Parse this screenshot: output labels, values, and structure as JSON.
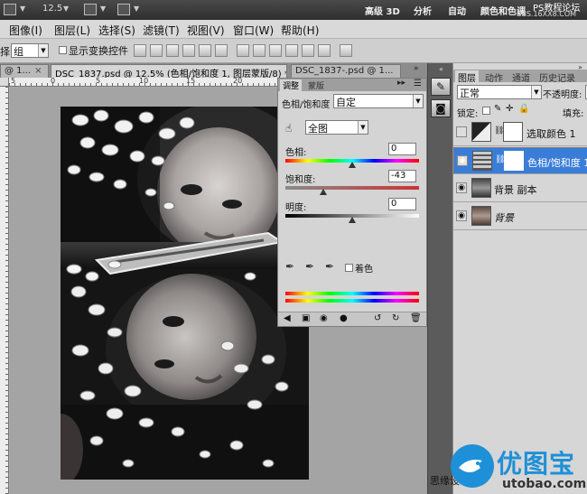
{
  "appbar": {
    "zoom": "12.5",
    "workspaces": [
      "高级 3D",
      "分析",
      "自动",
      "颜色和色调"
    ],
    "overlay_top": "PS教程论坛",
    "overlay_bottom": "BBS.16XX8.COM"
  },
  "menu": [
    "图像(I)",
    "图层(L)",
    "选择(S)",
    "滤镜(T)",
    "视图(V)",
    "窗口(W)",
    "帮助(H)"
  ],
  "options": {
    "left_label": "择:",
    "group_value": "组",
    "show_transform": "显示变换控件"
  },
  "tabs": [
    {
      "label": "@ 1...",
      "close": "×"
    },
    {
      "label": "DSC_1837.psd @ 12.5% (色相/饱和度 1, 图层蒙版/8) *",
      "close": "×"
    },
    {
      "label": "DSC_1837-.psd @ 1...",
      "close": ""
    }
  ],
  "ruler_labels": [
    "5",
    "0",
    "5",
    "10",
    "15",
    "20",
    "25",
    "30",
    "35"
  ],
  "adjustments": {
    "tab_adjust": "调整",
    "tab_mask": "蒙版",
    "title": "色相/饱和度",
    "preset_value": "自定",
    "range_value": "全图",
    "hue_label": "色相:",
    "hue_value": "0",
    "hue_pos": 0.5,
    "sat_label": "饱和度:",
    "sat_value": "-43",
    "sat_pos": 0.285,
    "light_label": "明度:",
    "light_value": "0",
    "light_pos": 0.5,
    "colorize_label": "着色"
  },
  "layers_panel": {
    "tabs": [
      "图层",
      "动作",
      "通道",
      "历史记录"
    ],
    "blend_mode": "正常",
    "opacity_label": "不透明度:",
    "lock_label": "锁定:",
    "fill_label": "填充:",
    "layers": [
      {
        "name": "选取颜色 1",
        "selected": false
      },
      {
        "name": "色相/饱和度 1",
        "selected": true
      },
      {
        "name": "背景 副本",
        "selected": false
      },
      {
        "name": "背景",
        "selected": false
      }
    ]
  },
  "status_text": "思缘设",
  "watermark": {
    "brand": "优图宝",
    "url": "utobao.com"
  },
  "colors": {
    "selected_layer": "#3a7dd8",
    "watermark_blue": "#1e90d8"
  }
}
